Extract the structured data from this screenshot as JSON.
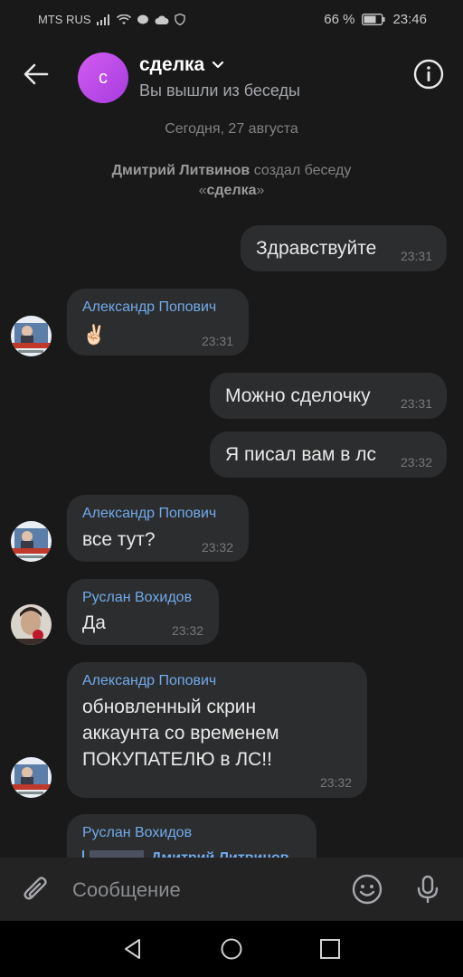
{
  "status_bar": {
    "carrier": "MTS RUS",
    "battery": "66 %",
    "time": "23:46",
    "icons": [
      "signal-icon",
      "wifi-icon",
      "message-icon",
      "cloud-icon",
      "shield-icon",
      "battery-icon"
    ]
  },
  "header": {
    "avatar_letter": "с",
    "title": "сделка",
    "subtitle": "Вы вышли из беседы"
  },
  "date_separator": "Сегодня, 27 августа",
  "system_message": {
    "author": "Дмитрий Литвинов",
    "text": "создал беседу",
    "chat_name_open": "«",
    "chat_name": "сделка",
    "chat_name_close": "»"
  },
  "messages": [
    {
      "outgoing": true,
      "text": "Здравствуйте",
      "time": "23:31"
    },
    {
      "outgoing": false,
      "author": "Александр Попович",
      "text": "✌🏻",
      "time": "23:31"
    },
    {
      "outgoing": true,
      "text": "Можно сделочку",
      "time": "23:31"
    },
    {
      "outgoing": true,
      "text": "Я писал вам в лс",
      "time": "23:32"
    },
    {
      "outgoing": false,
      "author": "Александр Попович",
      "text": "все тут?",
      "time": "23:32"
    },
    {
      "outgoing": false,
      "author": "Руслан Вохидов",
      "text": "Да",
      "time": "23:32"
    },
    {
      "outgoing": false,
      "author": "Александр Попович",
      "lines": [
        "обновленный скрин",
        "аккаунта со временем",
        "ПОКУПАТЕЛЮ в ЛС!!"
      ],
      "time": "23:32"
    },
    {
      "outgoing": false,
      "author": "Руслан Вохидов",
      "reply_author": "Дмитрий Литвинов"
    }
  ],
  "input": {
    "placeholder": "Сообщение"
  },
  "colors": {
    "background": "#19191a",
    "bubble": "#2c2d2e",
    "author_name": "#71aaeb",
    "avatar_gradient": "#c04ce6"
  }
}
